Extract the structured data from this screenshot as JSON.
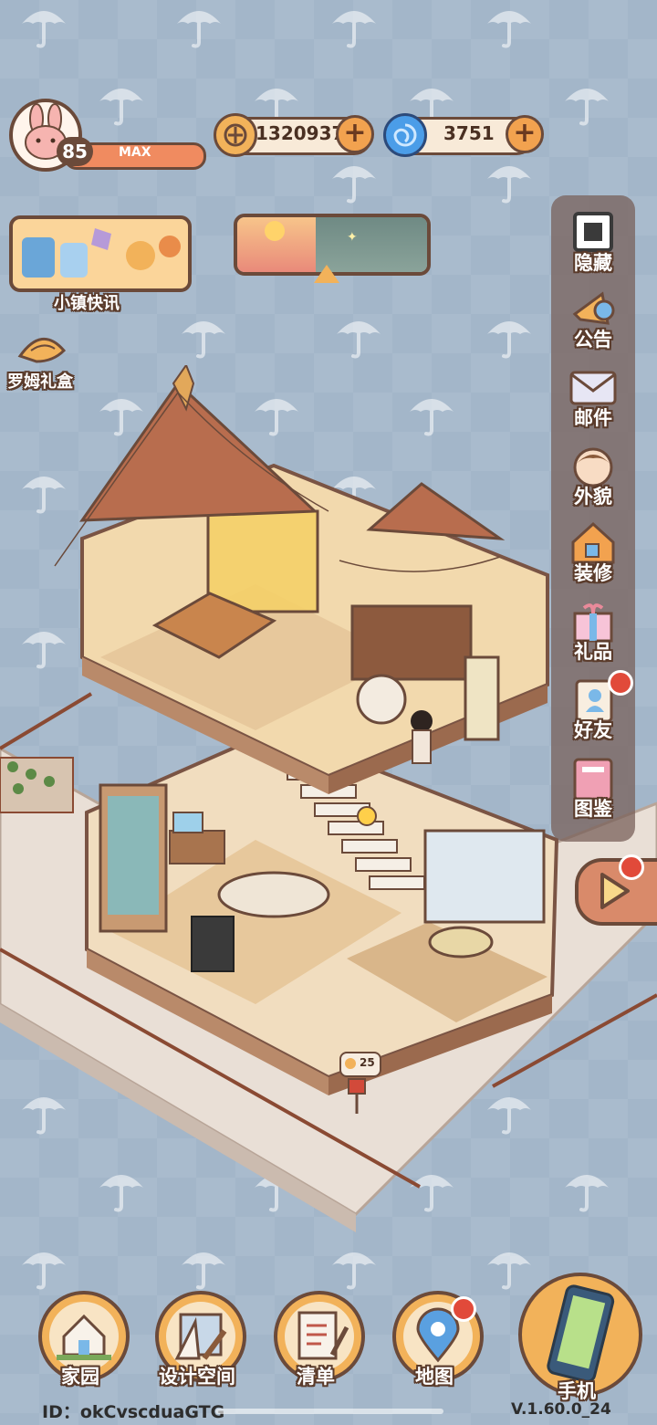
{
  "player": {
    "level": "85",
    "level_status": "MAX",
    "avatar_icon": "bunny-avatar-icon"
  },
  "currencies": {
    "coins": "1320937",
    "gems": "3751",
    "coin_icon": "coin-icon",
    "gem_icon": "swirl-gem-icon"
  },
  "left_menu": {
    "news_label": "小镇快讯",
    "gift_label": "罗姆礼盒"
  },
  "right_menu": [
    {
      "label": "隐藏",
      "icon": "hide-frame-icon"
    },
    {
      "label": "公告",
      "icon": "megaphone-icon"
    },
    {
      "label": "邮件",
      "icon": "envelope-icon"
    },
    {
      "label": "外貌",
      "icon": "character-face-icon"
    },
    {
      "label": "装修",
      "icon": "house-wrench-icon"
    },
    {
      "label": "礼品",
      "icon": "gift-box-icon"
    },
    {
      "label": "好友",
      "icon": "contacts-book-icon"
    },
    {
      "label": "图鉴",
      "icon": "collection-book-icon"
    }
  ],
  "mailbox_count": "25",
  "bottom_nav": [
    {
      "label": "家园",
      "icon": "home-icon"
    },
    {
      "label": "设计空间",
      "icon": "design-ruler-icon"
    },
    {
      "label": "清单",
      "icon": "checklist-icon"
    },
    {
      "label": "地图",
      "icon": "map-pin-icon"
    },
    {
      "label": "手机",
      "icon": "phone-icon"
    }
  ],
  "footer": {
    "user_id": "ID：okCvscduaGTG",
    "version": "V.1.60.0_24"
  },
  "colors": {
    "background": "#a3b6c9",
    "outline": "#6b4a3a",
    "accent": "#f2b25a",
    "notification": "#e14a3a"
  }
}
